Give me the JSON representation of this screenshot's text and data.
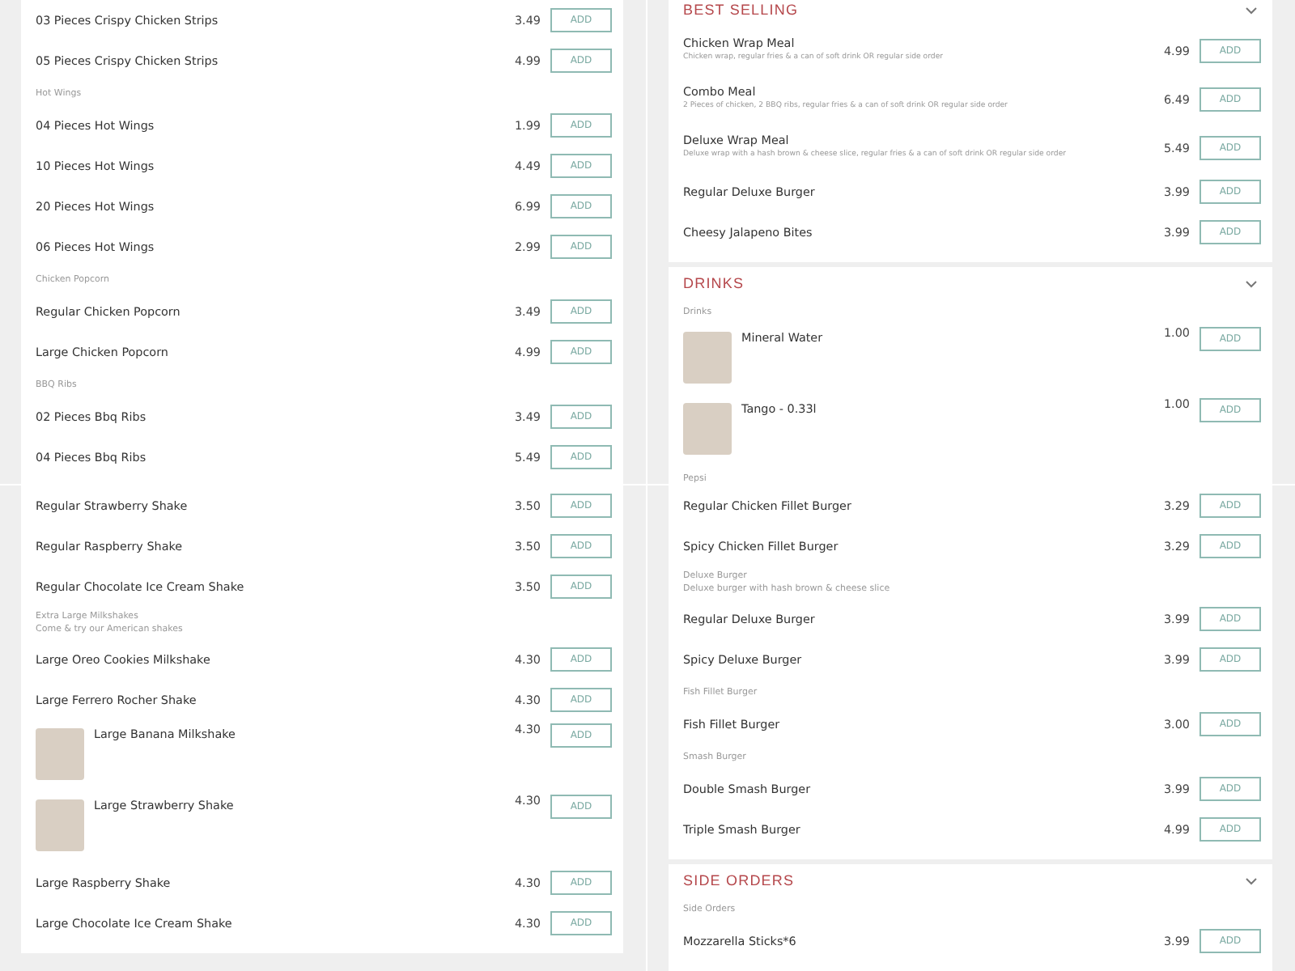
{
  "panels": [
    {
      "cards": [
        {
          "entries": [
            {
              "kind": "item",
              "name": "03 Pieces Crispy Chicken Strips",
              "price": "3.49",
              "button": "ADD"
            },
            {
              "kind": "item",
              "name": "05 Pieces Crispy Chicken Strips",
              "price": "4.99",
              "button": "ADD"
            },
            {
              "kind": "subheading",
              "text": "Hot Wings"
            },
            {
              "kind": "item",
              "name": "04 Pieces Hot Wings",
              "price": "1.99",
              "button": "ADD"
            },
            {
              "kind": "item",
              "name": "10 Pieces Hot Wings",
              "price": "4.49",
              "button": "ADD"
            },
            {
              "kind": "item",
              "name": "20 Pieces Hot Wings",
              "price": "6.99",
              "button": "ADD"
            },
            {
              "kind": "item",
              "name": "06 Pieces Hot Wings",
              "price": "2.99",
              "button": "ADD"
            },
            {
              "kind": "subheading",
              "text": "Chicken Popcorn"
            },
            {
              "kind": "item",
              "name": "Regular Chicken Popcorn",
              "price": "3.49",
              "button": "ADD"
            },
            {
              "kind": "item",
              "name": "Large Chicken Popcorn",
              "price": "4.99",
              "button": "ADD"
            },
            {
              "kind": "subheading",
              "text": "BBQ Ribs"
            },
            {
              "kind": "item",
              "name": "02 Pieces Bbq Ribs",
              "price": "3.49",
              "button": "ADD"
            },
            {
              "kind": "item",
              "name": "04 Pieces Bbq Ribs",
              "price": "5.49",
              "button": "ADD"
            }
          ]
        }
      ]
    },
    {
      "cards": [
        {
          "entries": [
            {
              "kind": "item",
              "name": "Regular Strawberry Shake",
              "price": "3.50",
              "button": "ADD"
            },
            {
              "kind": "item",
              "name": "Regular Raspberry Shake",
              "price": "3.50",
              "button": "ADD"
            },
            {
              "kind": "item",
              "name": "Regular Chocolate Ice Cream Shake",
              "price": "3.50",
              "button": "ADD"
            },
            {
              "kind": "subheading",
              "text": "Extra Large Milkshakes",
              "note": "Come & try our American shakes"
            },
            {
              "kind": "item",
              "name": "Large Oreo Cookies Milkshake",
              "price": "4.30",
              "button": "ADD"
            },
            {
              "kind": "item",
              "name": "Large Ferrero Rocher Shake",
              "price": "4.30",
              "button": "ADD"
            },
            {
              "kind": "photo-item",
              "name": "Large Banana Milkshake",
              "price": "4.30",
              "button": "ADD"
            },
            {
              "kind": "photo-item",
              "name": "Large Strawberry Shake",
              "price": "4.30",
              "button": "ADD"
            },
            {
              "kind": "item",
              "name": "Large Raspberry Shake",
              "price": "4.30",
              "button": "ADD"
            },
            {
              "kind": "item",
              "name": "Large Chocolate Ice Cream Shake",
              "price": "4.30",
              "button": "ADD"
            }
          ]
        }
      ]
    },
    {
      "cards": [
        {
          "title": "BEST SELLING",
          "entries": [
            {
              "kind": "item",
              "name": "Chicken Wrap Meal",
              "description": "Chicken wrap, regular fries & a can of soft drink OR regular side order",
              "price": "4.99",
              "button": "ADD"
            },
            {
              "kind": "item",
              "name": "Combo Meal",
              "description": "2 Pieces of chicken, 2 BBQ ribs, regular fries & a can of soft drink OR regular side order",
              "price": "6.49",
              "button": "ADD"
            },
            {
              "kind": "item",
              "name": "Deluxe Wrap Meal",
              "description": "Deluxe wrap with a hash brown & cheese slice, regular fries & a can of soft drink OR regular side order",
              "price": "5.49",
              "button": "ADD"
            },
            {
              "kind": "item",
              "name": "Regular Deluxe Burger",
              "price": "3.99",
              "button": "ADD"
            },
            {
              "kind": "item",
              "name": "Cheesy Jalapeno Bites",
              "price": "3.99",
              "button": "ADD"
            }
          ]
        },
        {
          "title": "DRINKS",
          "entries": [
            {
              "kind": "subheading",
              "text": "Drinks"
            },
            {
              "kind": "photo-item",
              "name": "Mineral Water",
              "price": "1.00",
              "button": "ADD"
            },
            {
              "kind": "photo-item",
              "name": "Tango - 0.33l",
              "price": "1.00",
              "button": "ADD"
            },
            {
              "kind": "subheading",
              "text": "Pepsi"
            }
          ]
        }
      ]
    },
    {
      "cards": [
        {
          "entries": [
            {
              "kind": "item",
              "name": "Regular Chicken Fillet Burger",
              "price": "3.29",
              "button": "ADD"
            },
            {
              "kind": "item",
              "name": "Spicy Chicken Fillet Burger",
              "price": "3.29",
              "button": "ADD"
            },
            {
              "kind": "subheading",
              "text": "Deluxe Burger",
              "note": "Deluxe burger with hash brown & cheese slice"
            },
            {
              "kind": "item",
              "name": "Regular Deluxe Burger",
              "price": "3.99",
              "button": "ADD"
            },
            {
              "kind": "item",
              "name": "Spicy Deluxe Burger",
              "price": "3.99",
              "button": "ADD"
            },
            {
              "kind": "subheading",
              "text": "Fish Fillet Burger"
            },
            {
              "kind": "item",
              "name": "Fish Fillet Burger",
              "price": "3.00",
              "button": "ADD"
            },
            {
              "kind": "subheading",
              "text": "Smash Burger"
            },
            {
              "kind": "item",
              "name": "Double Smash Burger",
              "price": "3.99",
              "button": "ADD"
            },
            {
              "kind": "item",
              "name": "Triple Smash Burger",
              "price": "4.99",
              "button": "ADD"
            }
          ]
        },
        {
          "title": "SIDE ORDERS",
          "entries": [
            {
              "kind": "subheading",
              "text": "Side Orders"
            },
            {
              "kind": "item",
              "name": "Mozzarella Sticks*6",
              "price": "3.99",
              "button": "ADD"
            }
          ]
        }
      ]
    }
  ]
}
